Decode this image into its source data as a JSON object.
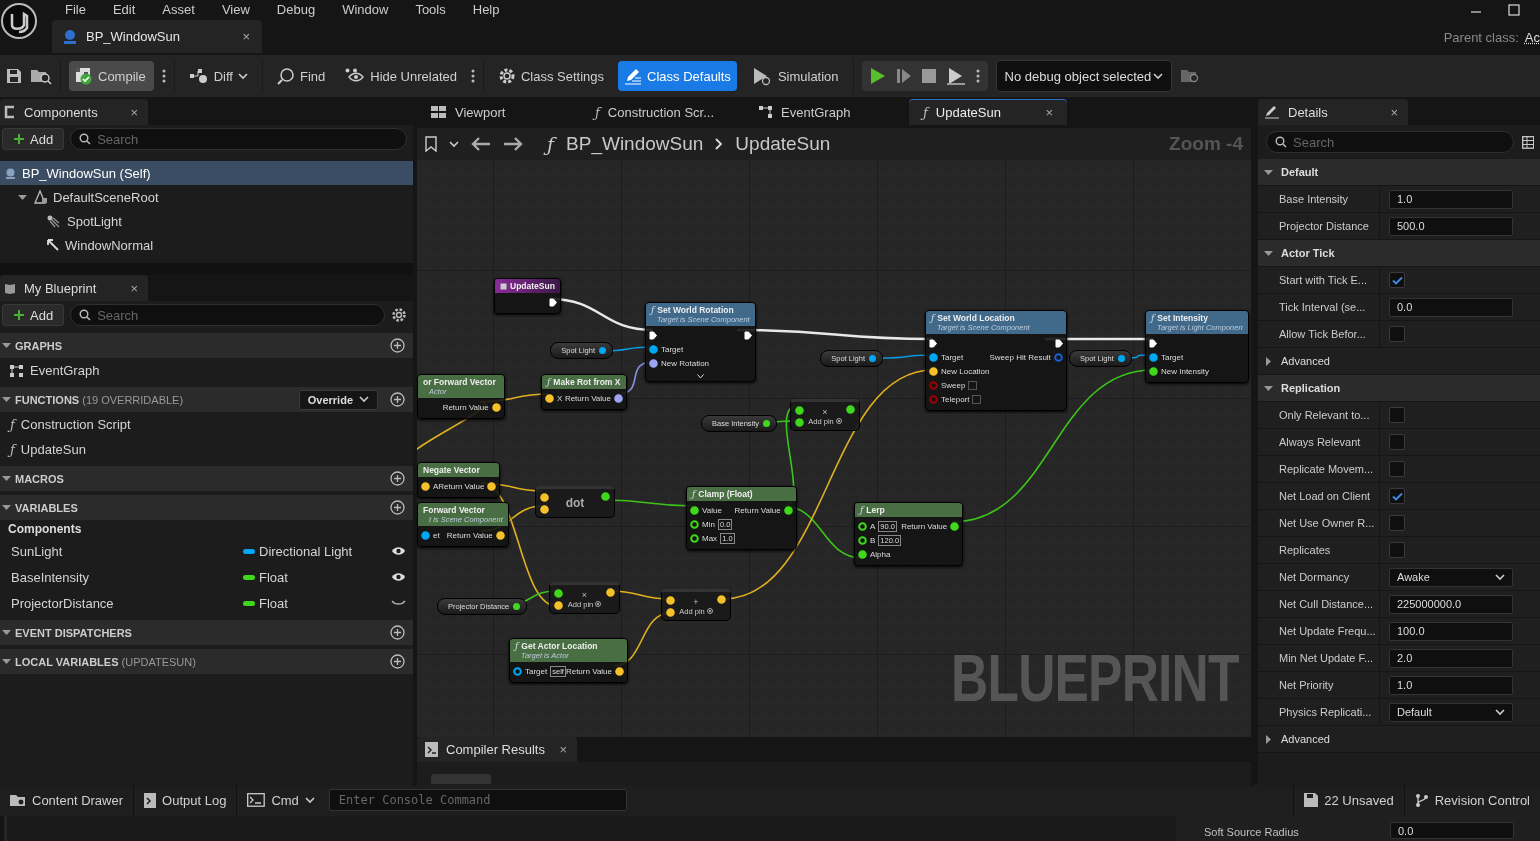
{
  "menu": [
    "File",
    "Edit",
    "Asset",
    "View",
    "Debug",
    "Window",
    "Tools",
    "Help"
  ],
  "document_tab": {
    "title": "BP_WindowSun",
    "close": "×"
  },
  "parent_class": {
    "label": "Parent class:",
    "value": "Ac"
  },
  "toolbar": {
    "compile": "Compile",
    "diff": "Diff",
    "find": "Find",
    "hide_unrelated": "Hide Unrelated",
    "simulation": "Simulation",
    "debug_object": "No debug object selected",
    "mode_buttons": [
      {
        "label": "Class Settings",
        "kind": "settings",
        "selected": false
      },
      {
        "label": "Class Defaults",
        "kind": "defaults",
        "selected": true
      }
    ]
  },
  "components_panel": {
    "tab": "Components",
    "close": "×",
    "add": "Add",
    "search_placeholder": "Search",
    "tree": [
      {
        "label": "BP_WindowSun (Self)",
        "kind": "actor",
        "selected": true,
        "children": [
          {
            "label": "DefaultSceneRoot",
            "kind": "scene",
            "selected": false,
            "expanded": true,
            "children": [
              {
                "label": "SpotLight",
                "kind": "spotlight",
                "selected": false
              },
              {
                "label": "WindowNormal",
                "kind": "arrow",
                "selected": false
              }
            ]
          }
        ]
      }
    ]
  },
  "my_blueprint": {
    "tab": "My Blueprint",
    "close": "×",
    "add": "Add",
    "search_placeholder": "Search",
    "sections": [
      {
        "title": "GRAPHS",
        "items": [
          {
            "label": "EventGraph",
            "kind": "graph"
          }
        ]
      },
      {
        "title": "FUNCTIONS",
        "note": "(19 OVERRIDABLE)",
        "override": "Override",
        "items": [
          {
            "label": "Construction Script",
            "kind": "function",
            "glyph": "ƒ"
          },
          {
            "label": "UpdateSun",
            "kind": "function",
            "glyph": "ƒ"
          }
        ]
      },
      {
        "title": "MACROS"
      },
      {
        "title": "VARIABLES",
        "categories": [
          {
            "label": "Components",
            "variables": [
              {
                "name": "SunLight",
                "type": "Directional Light",
                "color": "#00a8f4",
                "visible": true
              },
              {
                "name": "BaseIntensity",
                "type": "Float",
                "color": "#3fd81c",
                "visible": true
              },
              {
                "name": "ProjectorDistance",
                "type": "Float",
                "color": "#3fd81c",
                "visible": false
              }
            ]
          }
        ]
      },
      {
        "title": "EVENT DISPATCHERS"
      },
      {
        "title": "LOCAL VARIABLES",
        "note": "(UPDATESUN)"
      }
    ]
  },
  "graph_tabs": [
    {
      "label": "Viewport",
      "kind": "viewport",
      "selected": false
    },
    {
      "label": "Construction Scr...",
      "kind": "function",
      "glyph": "ƒ",
      "selected": false
    },
    {
      "label": "EventGraph",
      "kind": "graph",
      "selected": false
    },
    {
      "label": "UpdateSun",
      "kind": "function",
      "glyph": "ƒ",
      "selected": true,
      "close": "×"
    }
  ],
  "breadcrumb": {
    "glyph": "ƒ",
    "path": [
      "BP_WindowSun",
      "UpdateSun"
    ],
    "zoom": "Zoom -4"
  },
  "graph": {
    "label": "BLUEPRINT",
    "nodes": [
      {
        "kind": "event",
        "title": "UpdateSun",
        "outputs": [
          {
            "kind": "exec",
            "connected": true
          }
        ]
      },
      {
        "kind": "function",
        "title": "Set World Rotation",
        "subtitle": "Target is Scene Component",
        "color": "#40698a",
        "glyph": "ƒ",
        "has_advanced": true,
        "inputs": [
          {
            "kind": "exec",
            "connected": true
          },
          {
            "kind": "data",
            "label": "Target",
            "color": "#00a8f4",
            "connected": true
          },
          {
            "kind": "data",
            "label": "New Rotation",
            "color": "#9da3f5",
            "connected": true
          }
        ],
        "outputs": [
          {
            "kind": "exec",
            "connected": true
          }
        ]
      },
      {
        "kind": "variable",
        "label": "Spot Light",
        "color": "#00a8f4"
      },
      {
        "kind": "function",
        "title": "or Forward Vector",
        "subtitle": "Actor",
        "color": "#4a6e44",
        "outputs": [
          {
            "kind": "data",
            "label": "Return Value",
            "color": "#f4c12a",
            "connected": true
          }
        ]
      },
      {
        "kind": "function",
        "title": "Make Rot from X",
        "color": "#4a6e44",
        "glyph": "ƒ",
        "inputs": [
          {
            "kind": "data",
            "label": "X",
            "color": "#f4c12a",
            "connected": true
          }
        ],
        "outputs": [
          {
            "kind": "data",
            "label": "Return Value",
            "color": "#9da3f5",
            "connected": true
          }
        ]
      },
      {
        "kind": "variable",
        "label": "Spot Light",
        "color": "#00a8f4"
      },
      {
        "kind": "function",
        "title": "Set World Location",
        "subtitle": "Target is Scene Component",
        "color": "#40698a",
        "glyph": "ƒ",
        "inputs": [
          {
            "kind": "exec",
            "connected": true
          },
          {
            "kind": "data",
            "label": "Target",
            "color": "#00a8f4",
            "connected": true
          },
          {
            "kind": "data",
            "label": "New Location",
            "color": "#f4c12a",
            "connected": true
          },
          {
            "kind": "data",
            "label": "Sweep",
            "color": "#a00000",
            "connected": false,
            "checked": false
          },
          {
            "kind": "data",
            "label": "Teleport",
            "color": "#a00000",
            "connected": false,
            "checked": false
          }
        ],
        "outputs": [
          {
            "kind": "exec",
            "connected": true
          },
          {
            "kind": "data",
            "label": "Sweep Hit Result",
            "color": "#1a5fd6",
            "connected": false
          }
        ]
      },
      {
        "kind": "variable",
        "label": "Spot Light",
        "color": "#00a8f4"
      },
      {
        "kind": "function",
        "title": "Set Intensity",
        "subtitle": "Target is Light Componen",
        "color": "#40698a",
        "glyph": "ƒ",
        "inputs": [
          {
            "kind": "exec",
            "connected": true
          },
          {
            "kind": "data",
            "label": "Target",
            "color": "#00a8f4",
            "connected": true
          },
          {
            "kind": "data",
            "label": "New Intensity",
            "color": "#3fd81c",
            "connected": true
          }
        ]
      },
      {
        "kind": "variable",
        "label": "Base Intensity",
        "color": "#3fd81c"
      },
      {
        "kind": "compact",
        "symbol": "×",
        "add_pin": "Add pin",
        "inputs": [
          {
            "kind": "data",
            "color": "#3fd81c",
            "connected": true
          },
          {
            "kind": "data",
            "color": "#3fd81c",
            "connected": true
          }
        ],
        "outputs": [
          {
            "kind": "data",
            "color": "#3fd81c",
            "connected": true
          }
        ]
      },
      {
        "kind": "function",
        "title": "Negate Vector",
        "color": "#4a6e44",
        "inputs": [
          {
            "kind": "data",
            "label": "A",
            "color": "#f4c12a",
            "connected": true
          }
        ],
        "outputs": [
          {
            "kind": "data",
            "label": "Return Value",
            "color": "#f4c12a",
            "connected": true
          }
        ]
      },
      {
        "kind": "function",
        "title": "Forward Vector",
        "subtitle": "t is Scene Component",
        "color": "#4a6e44",
        "inputs": [
          {
            "kind": "data",
            "label": "et",
            "color": "#00a8f4",
            "connected": true
          }
        ],
        "outputs": [
          {
            "kind": "data",
            "label": "Return Value",
            "color": "#f4c12a",
            "connected": true
          }
        ]
      },
      {
        "kind": "compact",
        "symbol": "dot",
        "inputs": [
          {
            "kind": "data",
            "color": "#f4c12a",
            "connected": true
          },
          {
            "kind": "data",
            "color": "#f4c12a",
            "connected": true
          }
        ],
        "outputs": [
          {
            "kind": "data",
            "color": "#3fd81c",
            "connected": true
          }
        ]
      },
      {
        "kind": "function",
        "title": "Clamp (Float)",
        "color": "#4a6e44",
        "glyph": "ƒ",
        "inputs": [
          {
            "kind": "data",
            "label": "Value",
            "color": "#3fd81c",
            "connected": true
          },
          {
            "kind": "data",
            "label": "Min",
            "color": "#3fd81c",
            "connected": false,
            "value": "0.0"
          },
          {
            "kind": "data",
            "label": "Max",
            "color": "#3fd81c",
            "connected": false,
            "value": "1.0"
          }
        ],
        "outputs": [
          {
            "kind": "data",
            "label": "Return Value",
            "color": "#3fd81c",
            "connected": true
          }
        ]
      },
      {
        "kind": "function",
        "title": "Lerp",
        "color": "#4a6e44",
        "glyph": "ƒ",
        "inputs": [
          {
            "kind": "data",
            "label": "A",
            "color": "#3fd81c",
            "connected": false,
            "value": "90.0"
          },
          {
            "kind": "data",
            "label": "B",
            "color": "#3fd81c",
            "connected": false,
            "value": "120.0"
          },
          {
            "kind": "data",
            "label": "Alpha",
            "color": "#3fd81c",
            "connected": true
          }
        ],
        "outputs": [
          {
            "kind": "data",
            "label": "Return Value",
            "color": "#3fd81c",
            "connected": true
          }
        ]
      },
      {
        "kind": "variable",
        "label": "Projector Distance",
        "color": "#3fd81c"
      },
      {
        "kind": "compact",
        "symbol": "×",
        "add_pin": "Add pin",
        "inputs": [
          {
            "kind": "data",
            "color": "#3fd81c",
            "connected": true
          },
          {
            "kind": "data",
            "color": "#f4c12a",
            "connected": true
          }
        ],
        "outputs": [
          {
            "kind": "data",
            "color": "#f4c12a",
            "connected": true
          }
        ]
      },
      {
        "kind": "compact",
        "symbol": "+",
        "add_pin": "Add pin",
        "inputs": [
          {
            "kind": "data",
            "color": "#f4c12a",
            "connected": true
          },
          {
            "kind": "data",
            "color": "#f4c12a",
            "connected": true
          }
        ],
        "outputs": [
          {
            "kind": "data",
            "color": "#f4c12a",
            "connected": true
          }
        ]
      },
      {
        "kind": "function",
        "title": "Get Actor Location",
        "subtitle": "Target is Actor",
        "color": "#4a6e44",
        "glyph": "ƒ",
        "inputs": [
          {
            "kind": "data",
            "label": "Target",
            "color": "#00a8f4",
            "connected": false,
            "value": "self"
          }
        ],
        "outputs": [
          {
            "kind": "data",
            "label": "Return Value",
            "color": "#f4c12a",
            "connected": true
          }
        ]
      }
    ]
  },
  "compiler_results": {
    "tab": "Compiler Results",
    "close": "×"
  },
  "details": {
    "tab": "Details",
    "close": "×",
    "search_placeholder": "Search",
    "categories": [
      {
        "title": "Default",
        "kind": "header",
        "expanded": true,
        "properties": [
          {
            "label": "Base Intensity",
            "kind": "text",
            "value": "1.0"
          },
          {
            "label": "Projector Distance",
            "kind": "text",
            "value": "500.0"
          }
        ]
      },
      {
        "title": "Actor Tick",
        "kind": "header",
        "expanded": true,
        "properties": [
          {
            "label": "Start with Tick E...",
            "kind": "checkbox",
            "checked": true
          },
          {
            "label": "Tick Interval (se...",
            "kind": "text",
            "value": "0.0"
          },
          {
            "label": "Allow Tick Befor...",
            "kind": "checkbox",
            "checked": false
          }
        ]
      },
      {
        "title": "Advanced",
        "kind": "subgroup",
        "expanded": false
      },
      {
        "title": "Replication",
        "kind": "header",
        "expanded": true,
        "properties": [
          {
            "label": "Only Relevant to...",
            "kind": "checkbox",
            "checked": false
          },
          {
            "label": "Always Relevant",
            "kind": "checkbox",
            "checked": false
          },
          {
            "label": "Replicate Movem...",
            "kind": "checkbox",
            "checked": false
          },
          {
            "label": "Net Load on Client",
            "kind": "checkbox",
            "checked": true
          },
          {
            "label": "Net Use Owner R...",
            "kind": "checkbox",
            "checked": false
          },
          {
            "label": "Replicates",
            "kind": "checkbox",
            "checked": false
          },
          {
            "label": "Net Dormancy",
            "kind": "dropdown",
            "value": "Awake"
          },
          {
            "label": "Net Cull Distance...",
            "kind": "text",
            "value": "225000000.0"
          },
          {
            "label": "Net Update Frequ...",
            "kind": "text",
            "value": "100.0"
          },
          {
            "label": "Min Net Update F...",
            "kind": "text",
            "value": "2.0"
          },
          {
            "label": "Net Priority",
            "kind": "text",
            "value": "1.0"
          },
          {
            "label": "Physics Replicati...",
            "kind": "dropdown",
            "value": "Default"
          }
        ]
      },
      {
        "title": "Advanced",
        "kind": "subgroup",
        "expanded": false
      }
    ]
  },
  "details_lower": {
    "label": "Soft Source Radius",
    "value": "0.0"
  },
  "status_bar": {
    "content_drawer": "Content Drawer",
    "output_log": "Output Log",
    "cmd": "Cmd",
    "console_placeholder": "Enter Console Command",
    "unsaved": "22 Unsaved",
    "revision_control": "Revision Control"
  }
}
